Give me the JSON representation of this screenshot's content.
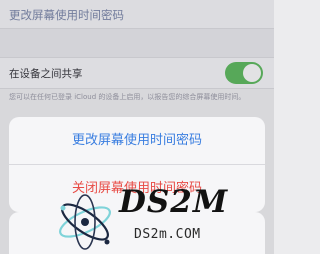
{
  "settings": {
    "change_passcode_label": "更改屏幕使用时间密码",
    "share_across_devices_label": "在设备之间共享",
    "share_toggle_on": true,
    "share_footnote": "您可以在任何已登录 iCloud 的设备上启用，以报告您的综合屏幕使用时间。"
  },
  "action_sheet": {
    "change_passcode": "更改屏幕使用时间密码",
    "turn_off_passcode": "关闭屏幕使用时间密码"
  },
  "watermark": {
    "logo_text": "DS2M",
    "url_text": "DS2m.COM"
  },
  "colors": {
    "accent_blue": "#3a7ee0",
    "destructive_red": "#e84b45",
    "toggle_green": "#5cb85c"
  }
}
